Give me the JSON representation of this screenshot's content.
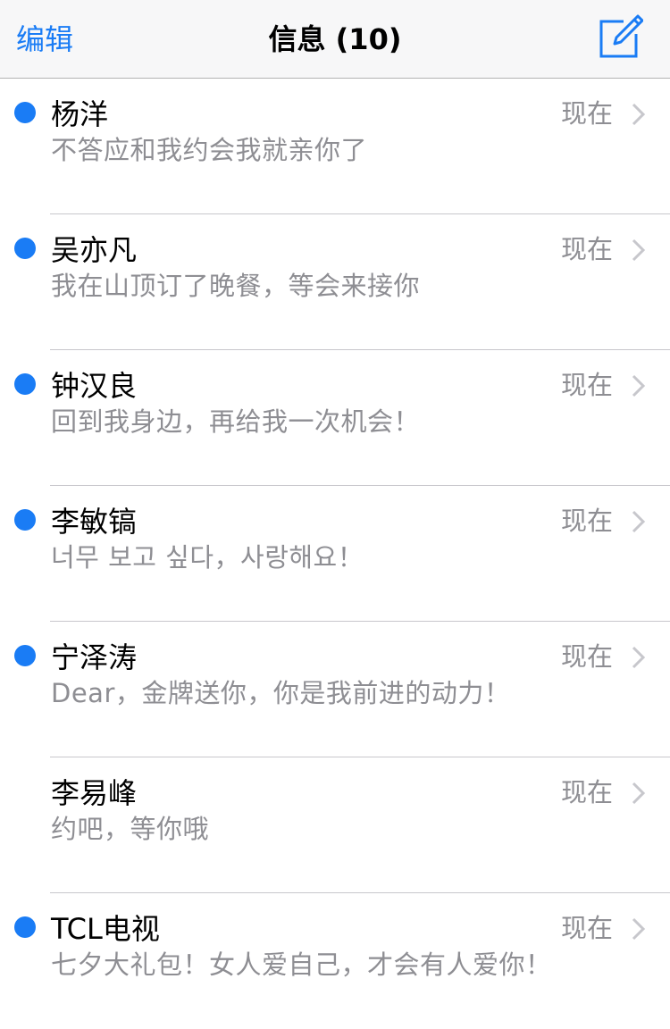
{
  "colors": {
    "accent": "#1a7cf5",
    "unread_dot": "#1a7cf5",
    "secondary_text": "#8e8e93",
    "separator": "#c8c7cc",
    "navbar_bg": "#f7f7f8"
  },
  "navbar": {
    "edit_label": "编辑",
    "title": "信息 (10)",
    "compose_icon": "compose-icon"
  },
  "messages": [
    {
      "name": "杨洋",
      "preview": "不答应和我约会我就亲你了",
      "time": "现在",
      "unread": true
    },
    {
      "name": "吴亦凡",
      "preview": "我在山顶订了晚餐，等会来接你",
      "time": "现在",
      "unread": true
    },
    {
      "name": "钟汉良",
      "preview": "回到我身边，再给我一次机会！",
      "time": "现在",
      "unread": true
    },
    {
      "name": "李敏镐",
      "preview": "너무 보고 싶다，사랑해요！",
      "time": "现在",
      "unread": true
    },
    {
      "name": "宁泽涛",
      "preview": "Dear，金牌送你，你是我前进的动力！",
      "time": "现在",
      "unread": true
    },
    {
      "name": "李易峰",
      "preview": "约吧，等你哦",
      "time": "现在",
      "unread": false
    },
    {
      "name": "TCL电视",
      "preview": "七夕大礼包！女人爱自己，才会有人爱你！",
      "time": "现在",
      "unread": true
    }
  ]
}
